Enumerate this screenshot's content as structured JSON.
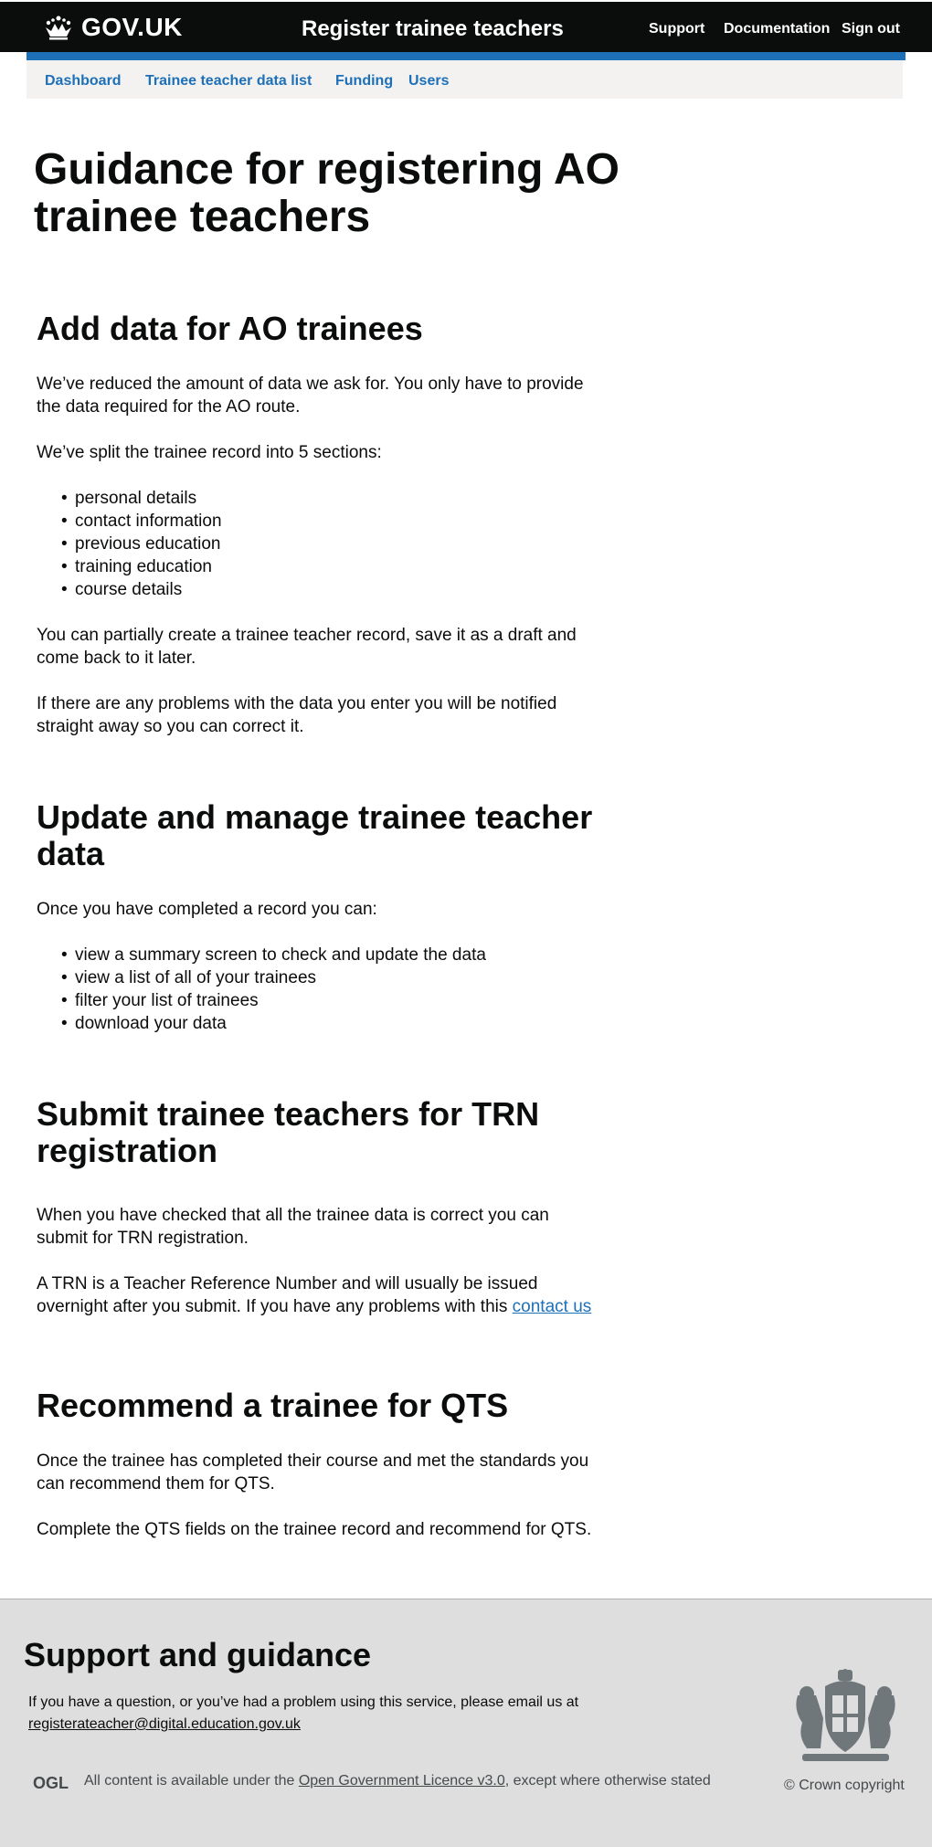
{
  "header": {
    "logo_text": "GOV.UK",
    "service_name": "Register trainee teachers",
    "nav": [
      "Support",
      "Documentation",
      "Sign out"
    ]
  },
  "subnav": [
    "Dashboard",
    "Trainee teacher data list",
    "Funding",
    "Users"
  ],
  "page_title": "Guidance for registering AO trainee teachers",
  "sections": {
    "add": {
      "heading": "Add data for AO trainees",
      "p1": "We’ve reduced the amount of data we ask for. You only have to provide the data required for the AO route.",
      "p2": "We’ve split the trainee record into 5 sections:",
      "list": [
        "personal details",
        "contact information",
        "previous education",
        "training education",
        "course details"
      ],
      "p3": "You can partially create a trainee teacher record, save it as a draft and come back to it later.",
      "p4": "If there are any problems with the data you enter you will be notified straight away so you can correct it."
    },
    "update": {
      "heading": "Update and manage trainee teacher data",
      "p1": "Once you have completed a record you can:",
      "list": [
        "view a summary screen to check and update the data",
        "view a list of all of your trainees",
        "filter your list of trainees",
        "download your data"
      ]
    },
    "submit": {
      "heading": "Submit trainee teachers for TRN registration",
      "p1": "When you have checked that all the trainee data is correct you can submit for TRN registration.",
      "p2": "A TRN is a Teacher Reference Number and will usually be issued overnight after you submit. If you have any problems with this",
      "p2_link": "contact us"
    },
    "qts": {
      "heading": "Recommend a trainee for QTS",
      "p1": "Once the trainee has completed their course and met the standards you can recommend them for QTS.",
      "p2": "Complete the QTS fields on the trainee record and recommend for QTS."
    }
  },
  "footer": {
    "heading": "Support and guidance",
    "text": "If you have a question, or you’ve had a problem using this service, please email us at",
    "email": "registerateacher@digital.education.gov.uk",
    "licence_pre": "All content is available under the",
    "licence_link": "Open Government Licence v3.0",
    "licence_post": ", except where otherwise stated",
    "ogl_label": "OGL",
    "copyright": "© Crown copyright"
  }
}
